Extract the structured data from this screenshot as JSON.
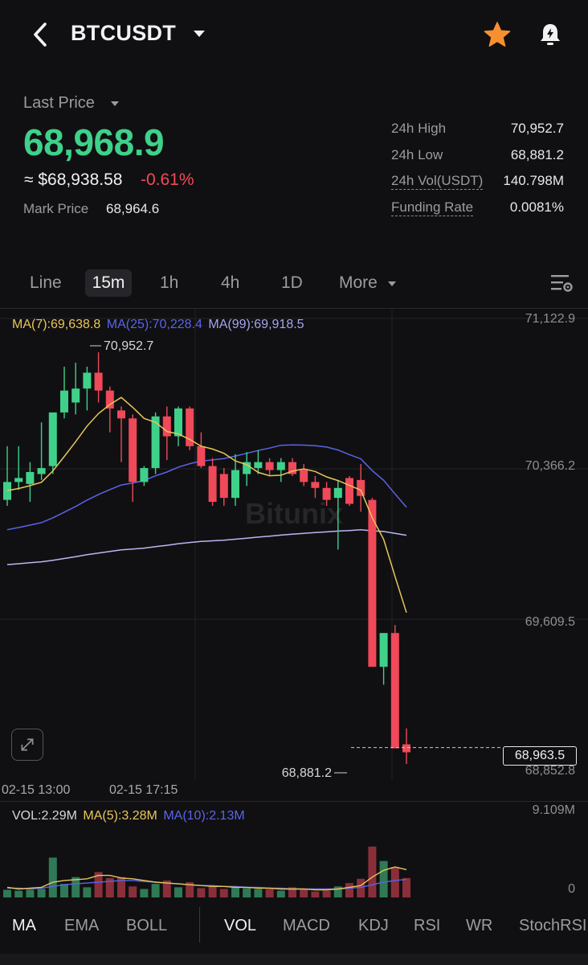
{
  "header": {
    "symbol": "BTCUSDT",
    "icons": [
      "back-arrow-icon",
      "dropdown-caret-icon",
      "star-icon",
      "price-alert-bell-icon"
    ],
    "star_color": "#f7902f"
  },
  "price": {
    "last_price_label": "Last Price",
    "last_price": "68,968.9",
    "usd_approx": "≈ $68,938.58",
    "change_pct": "-0.61%",
    "mark_price_label": "Mark Price",
    "mark_price": "68,964.6",
    "up_color": "#3fd18a",
    "down_color": "#f0495a"
  },
  "stats": [
    {
      "label": "24h High",
      "value": "70,952.7"
    },
    {
      "label": "24h Low",
      "value": "68,881.2"
    },
    {
      "label": "24h Vol(USDT)",
      "value": "140.798M"
    },
    {
      "label": "Funding Rate",
      "value": "0.0081%"
    }
  ],
  "timeframes": {
    "tabs": [
      "Line",
      "15m",
      "1h",
      "4h",
      "1D",
      "More"
    ],
    "active": "15m",
    "settings_icon": "chart-settings-icon"
  },
  "chart_data": {
    "type": "candlestick",
    "interval": "15m",
    "ma_legend": {
      "ma7": "MA(7):69,638.8",
      "ma25": "MA(25):70,228.4",
      "ma99": "MA(99):69,918.5",
      "ma7_color": "#e8c55a",
      "ma25_color": "#5b63e8",
      "ma99_color": "#b9b6f2"
    },
    "y_axis_labels": [
      "71,122.9",
      "70,366.2",
      "69,609.5",
      "68,852.8"
    ],
    "ylim": [
      68852.8,
      71122.9
    ],
    "x_axis_labels": [
      "02-15 13:00",
      "02-15 17:15"
    ],
    "high_marker": "70,952.7",
    "low_marker": "68,881.2",
    "current_price_tag": "68,963.5",
    "watermark": "Bitunix",
    "candles": [
      {
        "o": 70210,
        "h": 70480,
        "l": 70180,
        "c": 70300
      },
      {
        "o": 70300,
        "h": 70480,
        "l": 70260,
        "c": 70320
      },
      {
        "o": 70290,
        "h": 70400,
        "l": 70200,
        "c": 70350
      },
      {
        "o": 70340,
        "h": 70600,
        "l": 70310,
        "c": 70370
      },
      {
        "o": 70380,
        "h": 70610,
        "l": 70340,
        "c": 70650
      },
      {
        "o": 70650,
        "h": 70880,
        "l": 70620,
        "c": 70760
      },
      {
        "o": 70700,
        "h": 70900,
        "l": 70640,
        "c": 70770
      },
      {
        "o": 70770,
        "h": 70880,
        "l": 70660,
        "c": 70850
      },
      {
        "o": 70850,
        "h": 70952.7,
        "l": 70700,
        "c": 70760
      },
      {
        "o": 70760,
        "h": 70780,
        "l": 70550,
        "c": 70670
      },
      {
        "o": 70660,
        "h": 70680,
        "l": 70400,
        "c": 70620
      },
      {
        "o": 70620,
        "h": 70640,
        "l": 70200,
        "c": 70300
      },
      {
        "o": 70300,
        "h": 70380,
        "l": 70280,
        "c": 70370
      },
      {
        "o": 70370,
        "h": 70650,
        "l": 70340,
        "c": 70630
      },
      {
        "o": 70630,
        "h": 70680,
        "l": 70410,
        "c": 70530
      },
      {
        "o": 70530,
        "h": 70680,
        "l": 70480,
        "c": 70670
      },
      {
        "o": 70670,
        "h": 70680,
        "l": 70460,
        "c": 70480
      },
      {
        "o": 70480,
        "h": 70550,
        "l": 70370,
        "c": 70380
      },
      {
        "o": 70380,
        "h": 70420,
        "l": 70180,
        "c": 70200
      },
      {
        "o": 70340,
        "h": 70370,
        "l": 70180,
        "c": 70220
      },
      {
        "o": 70220,
        "h": 70440,
        "l": 70180,
        "c": 70360
      },
      {
        "o": 70340,
        "h": 70450,
        "l": 70280,
        "c": 70400
      },
      {
        "o": 70370,
        "h": 70460,
        "l": 70340,
        "c": 70400
      },
      {
        "o": 70400,
        "h": 70420,
        "l": 70330,
        "c": 70360
      },
      {
        "o": 70360,
        "h": 70420,
        "l": 70300,
        "c": 70400
      },
      {
        "o": 70400,
        "h": 70420,
        "l": 70330,
        "c": 70340
      },
      {
        "o": 70360,
        "h": 70390,
        "l": 70280,
        "c": 70300
      },
      {
        "o": 70300,
        "h": 70330,
        "l": 70220,
        "c": 70270
      },
      {
        "o": 70270,
        "h": 70300,
        "l": 70180,
        "c": 70210
      },
      {
        "o": 70220,
        "h": 70310,
        "l": 69960,
        "c": 70270
      },
      {
        "o": 70320,
        "h": 70330,
        "l": 70180,
        "c": 70190
      },
      {
        "o": 70310,
        "h": 70390,
        "l": 70150,
        "c": 70230
      },
      {
        "o": 70210,
        "h": 70220,
        "l": 69370,
        "c": 69370
      },
      {
        "o": 69370,
        "h": 69520,
        "l": 69280,
        "c": 69540
      },
      {
        "o": 69540,
        "h": 69580,
        "l": 68960,
        "c": 68960
      },
      {
        "o": 68980,
        "h": 69060,
        "l": 68881.2,
        "c": 68940
      }
    ]
  },
  "volume": {
    "vol_label": "VOL:2.29M",
    "ma5_label": "MA(5):3.28M",
    "ma10_label": "MA(10):2.13M",
    "ma5_color": "#e8c55a",
    "ma10_color": "#5b63e8",
    "axis_max": "9.109M",
    "axis_min": "0",
    "values": [
      0.9,
      0.8,
      0.9,
      1.0,
      4.7,
      1.6,
      2.4,
      1.2,
      3.0,
      2.3,
      2.4,
      1.3,
      1.0,
      1.6,
      2.0,
      1.2,
      1.8,
      1.1,
      1.3,
      1.0,
      1.2,
      1.1,
      1.0,
      1.0,
      0.8,
      1.2,
      0.9,
      0.7,
      0.8,
      1.3,
      1.7,
      2.2,
      6.0,
      4.3,
      3.6,
      2.29
    ],
    "ma5": [
      1.2,
      1.0,
      1.1,
      1.2,
      1.8,
      2.0,
      2.1,
      2.2,
      2.6,
      2.6,
      2.3,
      2.2,
      2.0,
      1.8,
      1.7,
      1.6,
      1.5,
      1.4,
      1.3,
      1.3,
      1.2,
      1.2,
      1.1,
      1.1,
      1.0,
      1.0,
      1.0,
      0.9,
      0.9,
      1.0,
      1.2,
      1.4,
      2.4,
      3.2,
      3.6,
      3.28
    ],
    "ma10": [
      1.1,
      1.1,
      1.0,
      1.1,
      1.3,
      1.5,
      1.6,
      1.7,
      1.8,
      1.9,
      2.0,
      2.0,
      1.9,
      1.8,
      1.7,
      1.6,
      1.5,
      1.4,
      1.4,
      1.3,
      1.3,
      1.2,
      1.2,
      1.1,
      1.1,
      1.0,
      1.0,
      1.0,
      1.0,
      1.0,
      1.1,
      1.2,
      1.5,
      1.8,
      2.0,
      2.13
    ]
  },
  "indicators": {
    "main": [
      "MA",
      "EMA",
      "BOLL"
    ],
    "sub": [
      "VOL",
      "MACD",
      "KDJ",
      "RSI",
      "WR",
      "StochRSI"
    ],
    "active_main": "MA",
    "active_sub": "VOL"
  }
}
